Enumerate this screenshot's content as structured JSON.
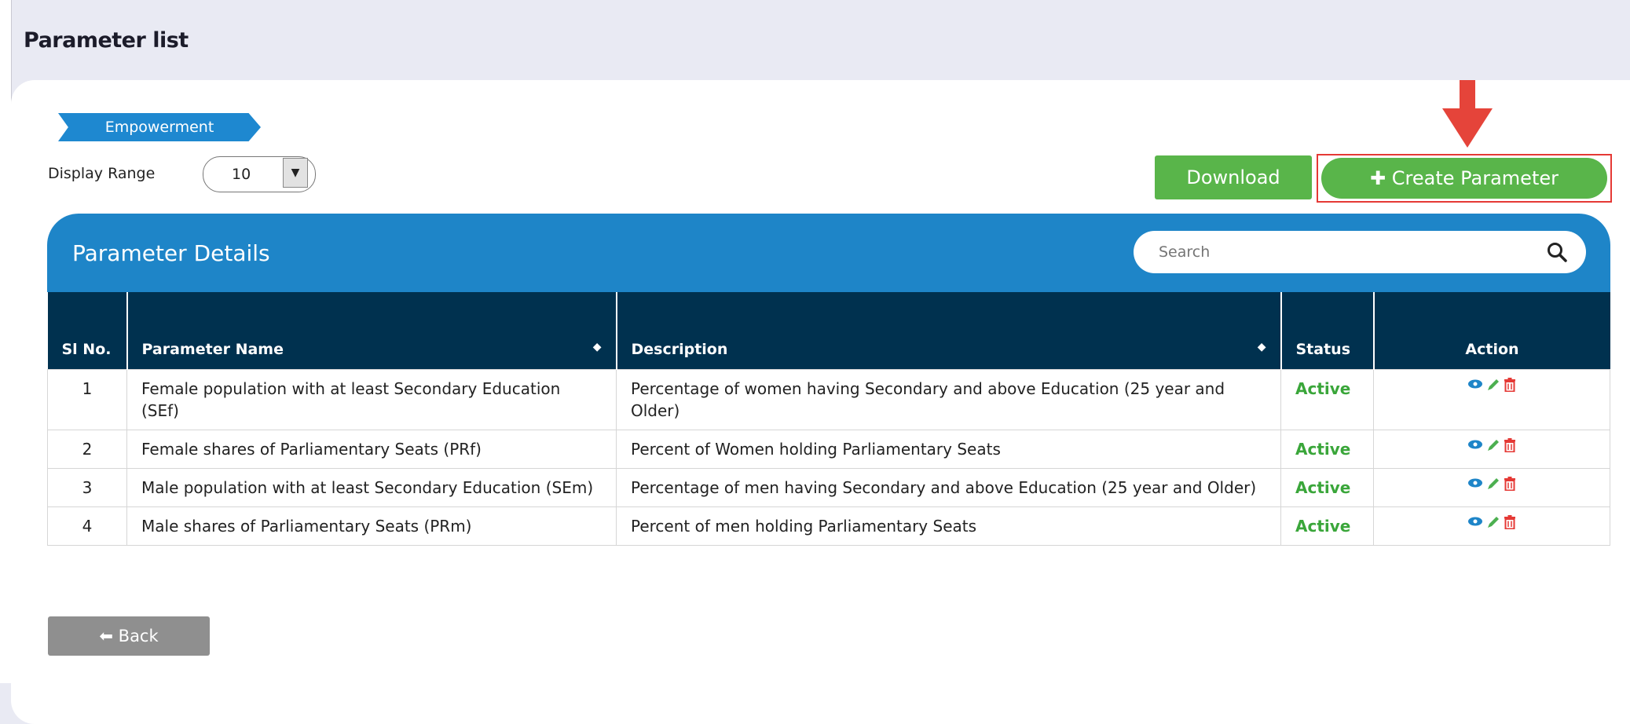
{
  "page": {
    "title": "Parameter list"
  },
  "breadcrumb": {
    "label": "Empowerment"
  },
  "display_range": {
    "label": "Display Range",
    "value": "10"
  },
  "toolbar": {
    "download_label": "Download",
    "create_label": "Create Parameter",
    "create_icon": "plus-icon"
  },
  "panel": {
    "title": "Parameter Details"
  },
  "search": {
    "placeholder": "Search"
  },
  "table": {
    "headers": {
      "sl": "Sl No.",
      "name": "Parameter Name",
      "description": "Description",
      "status": "Status",
      "action": "Action"
    },
    "rows": [
      {
        "sl": "1",
        "name": "Female population with at least Secondary Education (SEf)",
        "description": "Percentage of women having Secondary and above Education (25 year and Older)",
        "status": "Active"
      },
      {
        "sl": "2",
        "name": "Female shares of Parliamentary Seats (PRf)",
        "description": "Percent of Women holding Parliamentary Seats",
        "status": "Active"
      },
      {
        "sl": "3",
        "name": "Male population with at least Secondary Education (SEm)",
        "description": "Percentage of men having Secondary and above Education (25 year and Older)",
        "status": "Active"
      },
      {
        "sl": "4",
        "name": "Male shares of Parliamentary Seats (PRm)",
        "description": "Percent of men holding Parliamentary Seats",
        "status": "Active"
      }
    ]
  },
  "back": {
    "label": "Back"
  },
  "colors": {
    "accent": "#1e85c8",
    "header_dark": "#00314f",
    "success": "#59b54a",
    "danger": "#e53935"
  }
}
